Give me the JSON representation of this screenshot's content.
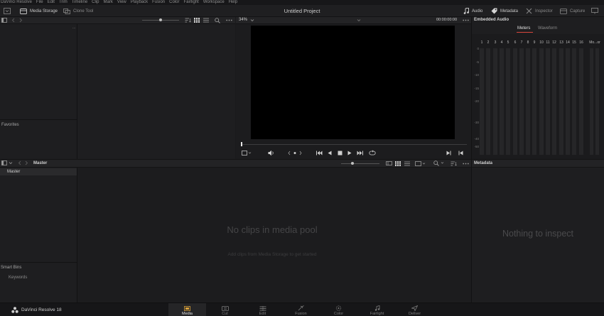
{
  "menu": [
    "DaVinci Resolve",
    "File",
    "Edit",
    "Trim",
    "Timeline",
    "Clip",
    "Mark",
    "View",
    "Playback",
    "Fusion",
    "Color",
    "Fairlight",
    "Workspace",
    "Help"
  ],
  "toolbar": {
    "media_storage": "Media Storage",
    "clone_tool": "Clone Tool",
    "project_title": "Untitled Project",
    "audio": "Audio",
    "metadata": "Metadata",
    "inspector": "Inspector",
    "capture": "Capture"
  },
  "viewer": {
    "zoom": "34%",
    "timecode": "00:00:00:00"
  },
  "audio_panel": {
    "title": "Embedded Audio",
    "tabs": [
      "Meters",
      "Waveform"
    ],
    "active_tab": "Meters",
    "channels": [
      "1",
      "2",
      "3",
      "4",
      "5",
      "6",
      "7",
      "8",
      "9",
      "10",
      "11",
      "12",
      "13",
      "14",
      "15",
      "16"
    ],
    "mono_label": "Mo...or",
    "scale": [
      "0",
      "-5",
      "-10",
      "-15",
      "-20",
      "-30",
      "-40",
      "-50"
    ]
  },
  "media_storage": {
    "favorites": "Favorites",
    "dot_label": "..."
  },
  "media_pool": {
    "header": "Master",
    "bin_master": "Master",
    "smart_bins": "Smart Bins",
    "keywords": "Keywords",
    "empty_title": "No clips in media pool",
    "empty_hint": "Add clips from Media Storage to get started"
  },
  "metadata_panel": {
    "title": "Metadata",
    "empty": "Nothing to inspect"
  },
  "app_footer": {
    "name": "DaVinci Resolve 18"
  },
  "pages": [
    {
      "label": "Media",
      "icon": "media-page-icon",
      "active": true
    },
    {
      "label": "Cut",
      "icon": "cut-page-icon",
      "active": false
    },
    {
      "label": "Edit",
      "icon": "edit-page-icon",
      "active": false
    },
    {
      "label": "Fusion",
      "icon": "fusion-page-icon",
      "active": false
    },
    {
      "label": "Color",
      "icon": "color-page-icon",
      "active": false
    },
    {
      "label": "Fairlight",
      "icon": "fairlight-page-icon",
      "active": false
    },
    {
      "label": "Deliver",
      "icon": "deliver-page-icon",
      "active": false
    }
  ],
  "colors": {
    "accent_red": "#d8463c",
    "background": "#1e1e20"
  }
}
